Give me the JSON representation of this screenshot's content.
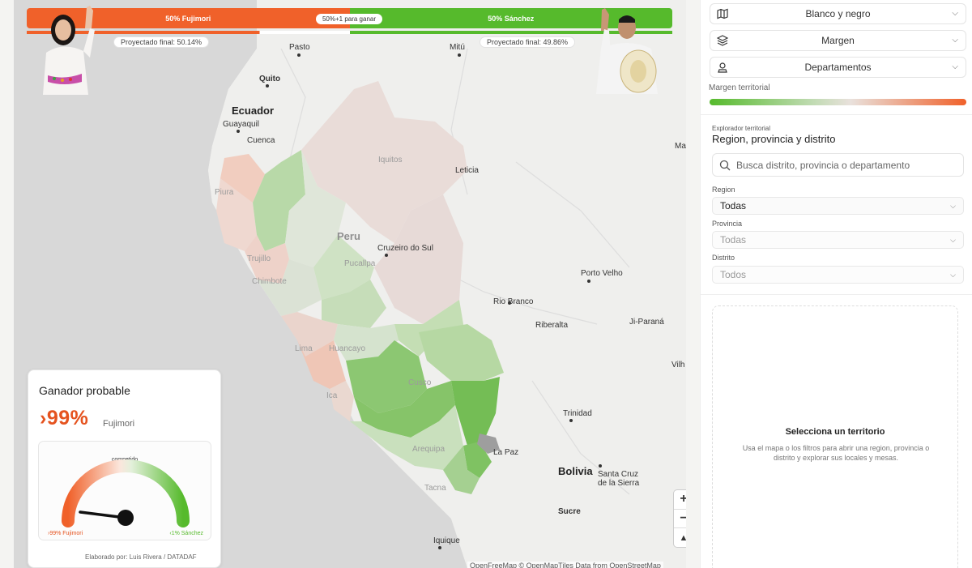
{
  "race": {
    "left_label": "50% Fujimori",
    "right_label": "50% Sánchez",
    "middle_label": "50%+1 para ganar",
    "left_projected": "Proyectado final: 50.14%",
    "right_projected": "Proyectado final: 49.86%",
    "left_color": "#f0612a",
    "right_color": "#56ba2c"
  },
  "map": {
    "labels": {
      "ecuador": "Ecuador",
      "quito": "Quito",
      "guayaquil": "Guayaquil",
      "cuenca": "Cuenca",
      "pasto": "Pasto",
      "mitu": "Mitú",
      "iquitos": "Iquitos",
      "leticia": "Leticia",
      "peru": "Peru",
      "piura": "Piura",
      "trujillo": "Trujillo",
      "chimbote": "Chimbote",
      "pucallpa": "Pucallpa",
      "cruzeiro": "Cruzeiro do Sul",
      "porto_velho": "Porto Velho",
      "rio_branco": "Rio Branco",
      "riberalta": "Riberalta",
      "ji_parana": "Ji-Paraná",
      "lima": "Lima",
      "huancayo": "Huancayo",
      "cusco": "Cusco",
      "ica": "Ica",
      "arequipa": "Arequipa",
      "tacna": "Tacna",
      "trinidad": "Trinidad",
      "la_paz": "La Paz",
      "bolivia": "Bolivia",
      "santa_cruz": "Santa Cruz",
      "de_la_sierra": "de la Sierra",
      "sucre": "Sucre",
      "iquique": "Iquique",
      "vilh": "Vilh",
      "ma": "Ma"
    },
    "attribution": "OpenFreeMap © OpenMapTiles Data from OpenStreetMap",
    "zoom_in": "+",
    "zoom_out": "−",
    "compass": "▲"
  },
  "winner": {
    "title": "Ganador probable",
    "percent": "›99%",
    "name": "Fujimori",
    "gauge_center": "competido",
    "gauge_left": "›99% Fujimori",
    "gauge_right": "‹1% Sánchez",
    "credit": "Elaborado por: Luis Rivera / DATADAF"
  },
  "panel": {
    "dropdown_style": "Blanco y negro",
    "dropdown_layer": "Margen",
    "dropdown_level": "Departamentos",
    "margin_label": "Margen territorial",
    "explorer_sub": "Explorador territorial",
    "explorer_title": "Region, provincia y distrito",
    "search_placeholder": "Busca distrito, provincia o departamento",
    "region_label": "Region",
    "region_value": "Todas",
    "provincia_label": "Provincia",
    "provincia_value": "Todas",
    "distrito_label": "Distrito",
    "distrito_value": "Todos",
    "territory_title": "Selecciona un territorio",
    "territory_desc": "Usa el mapa o los filtros para abrir una region, provincia o distrito y explorar sus locales y mesas."
  }
}
